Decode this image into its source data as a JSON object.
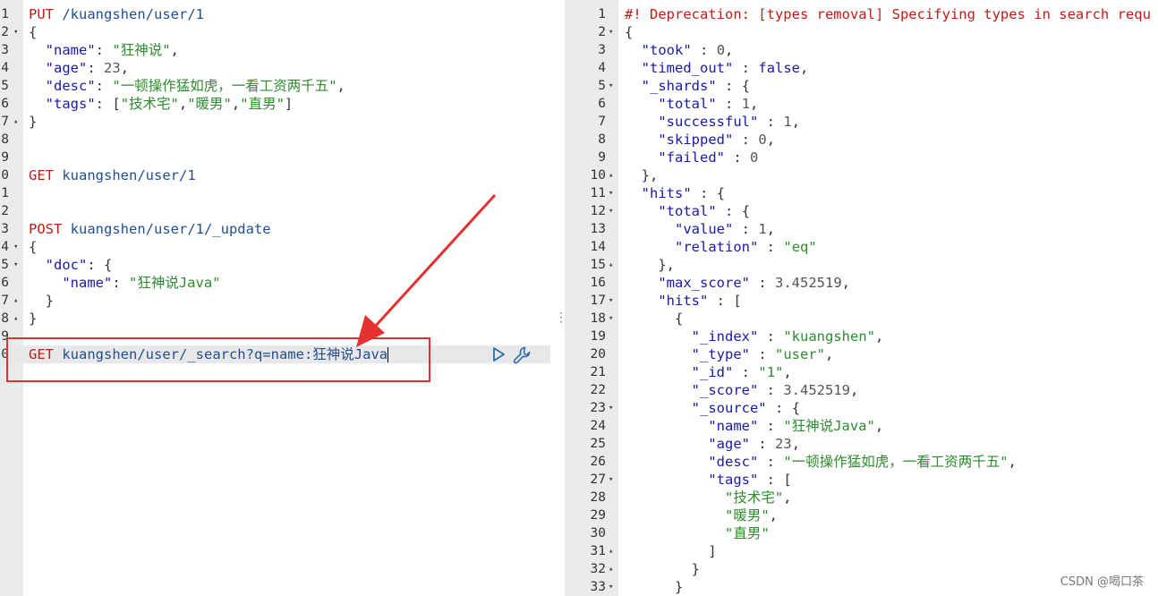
{
  "request_editor": {
    "lines": [
      {
        "n": "1",
        "fold": "",
        "html": "<span class=\"k\">PUT</span> <span class=\"url\">/kuangshen/user/1</span>"
      },
      {
        "n": "2",
        "fold": "▾",
        "html": "<span class=\"pu\">{</span>"
      },
      {
        "n": "3",
        "fold": "",
        "html": "  <span class=\"b\">\"name\"</span><span class=\"pu\">:</span> <span class=\"s\">\"狂神说\"</span><span class=\"pu\">,</span>"
      },
      {
        "n": "4",
        "fold": "",
        "html": "  <span class=\"b\">\"age\"</span><span class=\"pu\">:</span> <span class=\"n\">23</span><span class=\"pu\">,</span>"
      },
      {
        "n": "5",
        "fold": "",
        "html": "  <span class=\"b\">\"desc\"</span><span class=\"pu\">:</span> <span class=\"s\">\"一顿操作猛如虎，一看工资两千五\"</span><span class=\"pu\">,</span>"
      },
      {
        "n": "6",
        "fold": "",
        "html": "  <span class=\"b\">\"tags\"</span><span class=\"pu\">:</span> <span class=\"pu\">[</span><span class=\"s\">\"技术宅\"</span><span class=\"pu\">,</span><span class=\"s\">\"暖男\"</span><span class=\"pu\">,</span><span class=\"s\">\"直男\"</span><span class=\"pu\">]</span>"
      },
      {
        "n": "7",
        "fold": "▴",
        "html": "<span class=\"pu\">}</span>"
      },
      {
        "n": "8",
        "fold": "",
        "html": ""
      },
      {
        "n": "9",
        "fold": "",
        "html": ""
      },
      {
        "n": "0",
        "fold": "",
        "html": "<span class=\"k\">GET</span> <span class=\"url\">kuangshen/user/1</span>"
      },
      {
        "n": "1",
        "fold": "",
        "html": ""
      },
      {
        "n": "2",
        "fold": "",
        "html": ""
      },
      {
        "n": "3",
        "fold": "",
        "html": "<span class=\"k\">POST</span> <span class=\"url\">kuangshen/user/1/_update</span>"
      },
      {
        "n": "4",
        "fold": "▾",
        "html": "<span class=\"pu\">{</span>"
      },
      {
        "n": "5",
        "fold": "▾",
        "html": "  <span class=\"b\">\"doc\"</span><span class=\"pu\">:</span> <span class=\"pu\">{</span>"
      },
      {
        "n": "6",
        "fold": "",
        "html": "    <span class=\"b\">\"name\"</span><span class=\"pu\">:</span> <span class=\"s\">\"狂神说Java\"</span>"
      },
      {
        "n": "7",
        "fold": "▴",
        "html": "  <span class=\"pu\">}</span>"
      },
      {
        "n": "8",
        "fold": "▴",
        "html": "<span class=\"pu\">}</span>"
      },
      {
        "n": "9",
        "fold": "",
        "html": ""
      },
      {
        "n": "0",
        "fold": "",
        "active": true,
        "html": "<span class=\"k\">GET</span> <span class=\"url\">kuangshen/user/_search?q=name:狂神说Java</span><span class=\"cursor\"></span>"
      },
      {
        "n": "",
        "fold": "",
        "html": ""
      },
      {
        "n": "",
        "fold": "",
        "html": ""
      },
      {
        "n": "",
        "fold": "",
        "html": ""
      },
      {
        "n": "",
        "fold": "",
        "html": ""
      },
      {
        "n": "",
        "fold": "",
        "html": ""
      },
      {
        "n": "",
        "fold": "",
        "html": ""
      },
      {
        "n": "",
        "fold": "",
        "html": ""
      },
      {
        "n": "",
        "fold": "",
        "html": ""
      },
      {
        "n": "",
        "fold": "",
        "html": ""
      },
      {
        "n": "",
        "fold": "",
        "html": ""
      },
      {
        "n": "",
        "fold": "",
        "html": ""
      },
      {
        "n": "",
        "fold": "",
        "html": ""
      },
      {
        "n": "",
        "fold": "",
        "html": ""
      }
    ]
  },
  "response_viewer": {
    "lines": [
      {
        "n": "1",
        "fold": "",
        "html": "<span class=\"dep\">#! Deprecation: [types removal] Specifying types in search requ</span>"
      },
      {
        "n": "2",
        "fold": "▾",
        "html": "<span class=\"pu\">{</span>"
      },
      {
        "n": "3",
        "fold": "",
        "html": "  <span class=\"b\">\"took\"</span> <span class=\"pu\">:</span> <span class=\"n\">0</span><span class=\"pu\">,</span>"
      },
      {
        "n": "4",
        "fold": "",
        "html": "  <span class=\"b\">\"timed_out\"</span> <span class=\"pu\">:</span> <span class=\"b\">false</span><span class=\"pu\">,</span>"
      },
      {
        "n": "5",
        "fold": "▾",
        "html": "  <span class=\"b\">\"_shards\"</span> <span class=\"pu\">:</span> <span class=\"pu\">{</span>"
      },
      {
        "n": "6",
        "fold": "",
        "html": "    <span class=\"b\">\"total\"</span> <span class=\"pu\">:</span> <span class=\"n\">1</span><span class=\"pu\">,</span>"
      },
      {
        "n": "7",
        "fold": "",
        "html": "    <span class=\"b\">\"successful\"</span> <span class=\"pu\">:</span> <span class=\"n\">1</span><span class=\"pu\">,</span>"
      },
      {
        "n": "8",
        "fold": "",
        "html": "    <span class=\"b\">\"skipped\"</span> <span class=\"pu\">:</span> <span class=\"n\">0</span><span class=\"pu\">,</span>"
      },
      {
        "n": "9",
        "fold": "",
        "html": "    <span class=\"b\">\"failed\"</span> <span class=\"pu\">:</span> <span class=\"n\">0</span>"
      },
      {
        "n": "10",
        "fold": "▴",
        "html": "  <span class=\"pu\">},</span>"
      },
      {
        "n": "11",
        "fold": "▾",
        "html": "  <span class=\"b\">\"hits\"</span> <span class=\"pu\">:</span> <span class=\"pu\">{</span>"
      },
      {
        "n": "12",
        "fold": "▾",
        "html": "    <span class=\"b\">\"total\"</span> <span class=\"pu\">:</span> <span class=\"pu\">{</span>"
      },
      {
        "n": "13",
        "fold": "",
        "html": "      <span class=\"b\">\"value\"</span> <span class=\"pu\">:</span> <span class=\"n\">1</span><span class=\"pu\">,</span>"
      },
      {
        "n": "14",
        "fold": "",
        "html": "      <span class=\"b\">\"relation\"</span> <span class=\"pu\">:</span> <span class=\"s\">\"eq\"</span>"
      },
      {
        "n": "15",
        "fold": "▴",
        "html": "    <span class=\"pu\">},</span>"
      },
      {
        "n": "16",
        "fold": "",
        "html": "    <span class=\"b\">\"max_score\"</span> <span class=\"pu\">:</span> <span class=\"n\">3.452519</span><span class=\"pu\">,</span>"
      },
      {
        "n": "17",
        "fold": "▾",
        "html": "    <span class=\"b\">\"hits\"</span> <span class=\"pu\">:</span> <span class=\"pu\">[</span>"
      },
      {
        "n": "18",
        "fold": "▾",
        "html": "      <span class=\"pu\">{</span>"
      },
      {
        "n": "19",
        "fold": "",
        "html": "        <span class=\"b\">\"_index\"</span> <span class=\"pu\">:</span> <span class=\"s\">\"kuangshen\"</span><span class=\"pu\">,</span>"
      },
      {
        "n": "20",
        "fold": "",
        "html": "        <span class=\"b\">\"_type\"</span> <span class=\"pu\">:</span> <span class=\"s\">\"user\"</span><span class=\"pu\">,</span>"
      },
      {
        "n": "21",
        "fold": "",
        "html": "        <span class=\"b\">\"_id\"</span> <span class=\"pu\">:</span> <span class=\"s\">\"1\"</span><span class=\"pu\">,</span>"
      },
      {
        "n": "22",
        "fold": "",
        "html": "        <span class=\"b\">\"_score\"</span> <span class=\"pu\">:</span> <span class=\"n\">3.452519</span><span class=\"pu\">,</span>"
      },
      {
        "n": "23",
        "fold": "▾",
        "html": "        <span class=\"b\">\"_source\"</span> <span class=\"pu\">:</span> <span class=\"pu\">{</span>"
      },
      {
        "n": "24",
        "fold": "",
        "html": "          <span class=\"b\">\"name\"</span> <span class=\"pu\">:</span> <span class=\"s\">\"狂神说Java\"</span><span class=\"pu\">,</span>"
      },
      {
        "n": "25",
        "fold": "",
        "html": "          <span class=\"b\">\"age\"</span> <span class=\"pu\">:</span> <span class=\"n\">23</span><span class=\"pu\">,</span>"
      },
      {
        "n": "26",
        "fold": "",
        "html": "          <span class=\"b\">\"desc\"</span> <span class=\"pu\">:</span> <span class=\"s\">\"一顿操作猛如虎，一看工资两千五\"</span><span class=\"pu\">,</span>"
      },
      {
        "n": "27",
        "fold": "▾",
        "html": "          <span class=\"b\">\"tags\"</span> <span class=\"pu\">:</span> <span class=\"pu\">[</span>"
      },
      {
        "n": "28",
        "fold": "",
        "html": "            <span class=\"s\">\"技术宅\"</span><span class=\"pu\">,</span>"
      },
      {
        "n": "29",
        "fold": "",
        "html": "            <span class=\"s\">\"暖男\"</span><span class=\"pu\">,</span>"
      },
      {
        "n": "30",
        "fold": "",
        "html": "            <span class=\"s\">\"直男\"</span>"
      },
      {
        "n": "31",
        "fold": "▴",
        "html": "          <span class=\"pu\">]</span>"
      },
      {
        "n": "32",
        "fold": "▴",
        "html": "        <span class=\"pu\">}</span>"
      },
      {
        "n": "33",
        "fold": "▾",
        "html": "      <span class=\"pu\">}</span>"
      }
    ]
  },
  "watermark": "CSDN @喝口茶",
  "colors": {
    "annotation_red": "#e03030",
    "keyword_red": "#c41a16",
    "string_green": "#2e8b2e",
    "key_blue": "#1a1aa6"
  },
  "icons": {
    "run": "play-icon",
    "settings": "wrench-icon"
  }
}
